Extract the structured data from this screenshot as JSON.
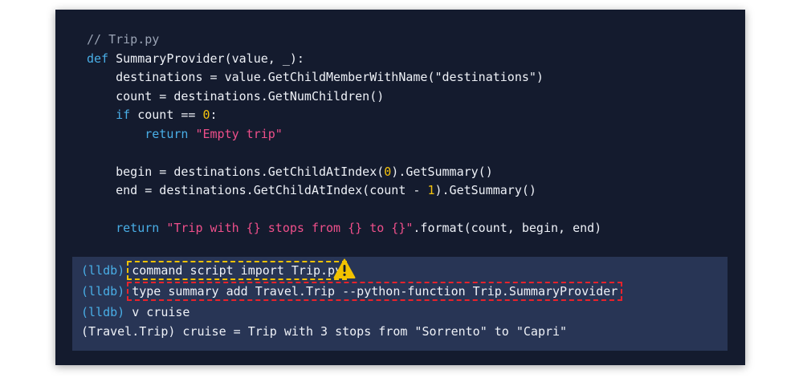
{
  "code": {
    "lines": [
      [
        {
          "c": "cm",
          "t": "// Trip.py"
        }
      ],
      [
        {
          "c": "kw",
          "t": "def"
        },
        {
          "c": "",
          "t": " SummaryProvider(value, _):"
        }
      ],
      [
        {
          "c": "",
          "t": "    destinations = value.GetChildMemberWithName("
        },
        {
          "c": "",
          "t": "\"destinations\""
        },
        {
          "c": "",
          "t": ")"
        }
      ],
      [
        {
          "c": "",
          "t": "    count = destinations.GetNumChildren()"
        }
      ],
      [
        {
          "c": "",
          "t": "    "
        },
        {
          "c": "kw",
          "t": "if"
        },
        {
          "c": "",
          "t": " count == "
        },
        {
          "c": "nm",
          "t": "0"
        },
        {
          "c": "",
          "t": ":"
        }
      ],
      [
        {
          "c": "",
          "t": "        "
        },
        {
          "c": "kw",
          "t": "return"
        },
        {
          "c": "",
          "t": " "
        },
        {
          "c": "st",
          "t": "\"Empty trip\""
        }
      ],
      [
        {
          "c": "",
          "t": ""
        }
      ],
      [
        {
          "c": "",
          "t": "    begin = destinations.GetChildAtIndex("
        },
        {
          "c": "nm",
          "t": "0"
        },
        {
          "c": "",
          "t": ").GetSummary()"
        }
      ],
      [
        {
          "c": "",
          "t": "    end = destinations.GetChildAtIndex(count - "
        },
        {
          "c": "nm",
          "t": "1"
        },
        {
          "c": "",
          "t": ").GetSummary()"
        }
      ],
      [
        {
          "c": "",
          "t": ""
        }
      ],
      [
        {
          "c": "",
          "t": "    "
        },
        {
          "c": "kw",
          "t": "return"
        },
        {
          "c": "",
          "t": " "
        },
        {
          "c": "st",
          "t": "\"Trip with {} stops from {} to {}\""
        },
        {
          "c": "",
          "t": ".format(count, begin, end)"
        }
      ]
    ]
  },
  "terminal": {
    "prompt": "(lldb)",
    "line1_cmd": "command script import Trip.py",
    "line2_cmd": "type summary add Travel.Trip --python-function Trip.SummaryProvider",
    "line3_cmd": "v cruise",
    "line4_output": "(Travel.Trip) cruise = Trip with 3 stops from \"Sorrento\" to \"Capri\""
  },
  "icons": {
    "warning": "warning-icon"
  },
  "colors": {
    "keyword": "#49aee6",
    "string": "#ee4f8a",
    "number": "#f4c20d",
    "warning": "#f2c200",
    "error": "#e8232b"
  }
}
